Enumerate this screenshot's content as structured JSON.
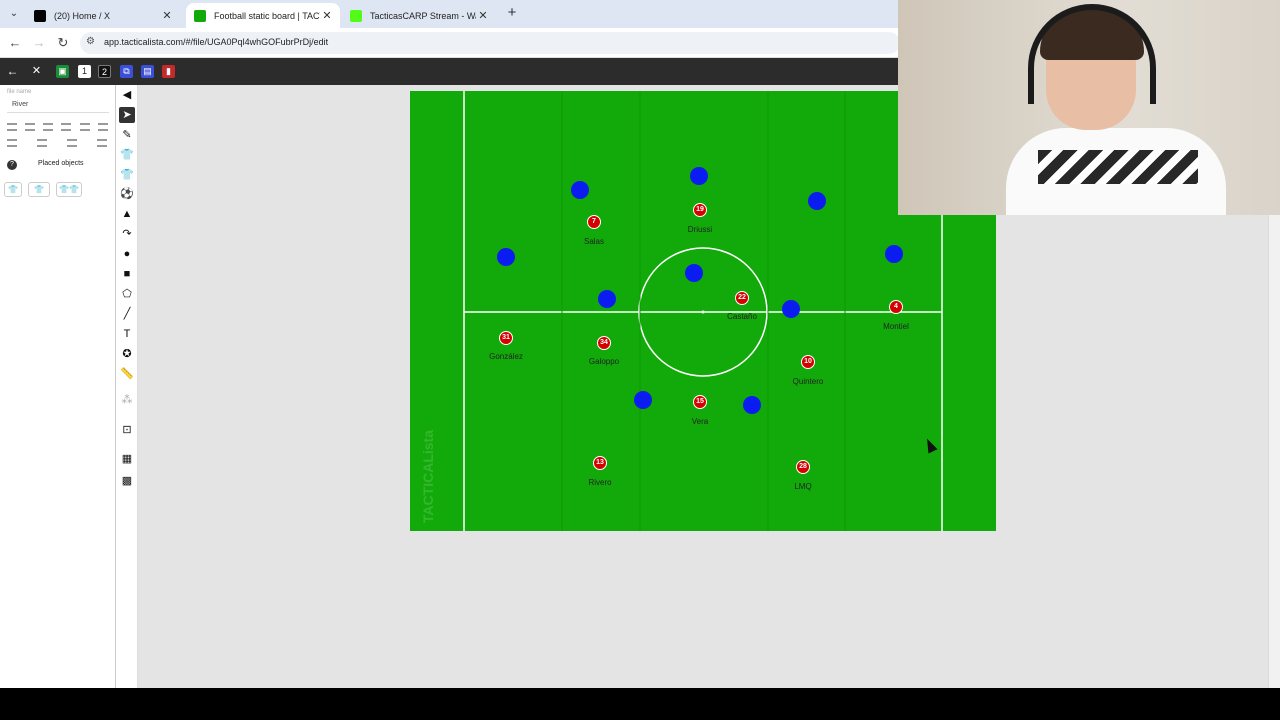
{
  "browser": {
    "tabs": [
      {
        "title": "(20) Home / X",
        "icon": "x-logo-icon",
        "color": "#000000"
      },
      {
        "title": "Football static board | TACTICA",
        "icon": "tacticalista-favicon-icon",
        "color": "#12aa0a"
      },
      {
        "title": "TacticasCARP Stream - Watch L",
        "icon": "kick-logo-icon",
        "color": "#53fc18"
      }
    ],
    "new_tab": "+",
    "url": "app.tacticalista.com/#/file/UGA0Pql4whGOFubrPrDj/edit"
  },
  "toolbar": {
    "page_1": "1",
    "page_2": "2",
    "accent": "#2c2c2c"
  },
  "left_panel": {
    "file_name_label": "file name",
    "file_name": "River",
    "placed_objects": "Placed objects",
    "help": "?"
  },
  "board": {
    "pitch_color": "#12aa0a",
    "team_color": "#d50000",
    "opponent_color": "#0a1cf0",
    "watermark": "TACTICALista",
    "players": [
      {
        "number": "7",
        "name": "Salas"
      },
      {
        "number": "19",
        "name": "Driussi"
      },
      {
        "number": "22",
        "name": "Castaño"
      },
      {
        "number": "4",
        "name": "Montiel"
      },
      {
        "number": "31",
        "name": "González"
      },
      {
        "number": "34",
        "name": "Galoppo"
      },
      {
        "number": "10",
        "name": "Quintero"
      },
      {
        "number": "15",
        "name": "Vera"
      },
      {
        "number": "13",
        "name": "Rivero"
      },
      {
        "number": "28",
        "name": "LMQ"
      }
    ]
  }
}
